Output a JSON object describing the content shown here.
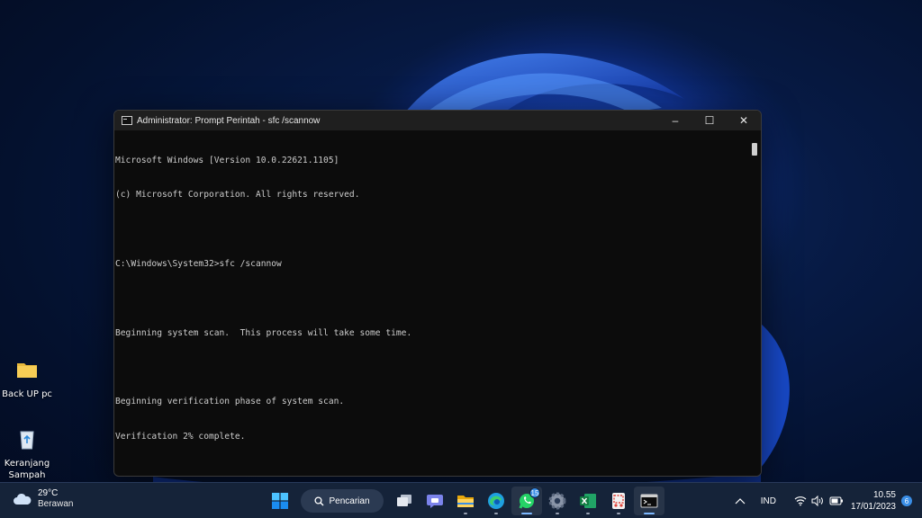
{
  "desktop": {
    "icons": [
      {
        "label": "Back UP pc"
      },
      {
        "label": "Keranjang\nSampah"
      }
    ]
  },
  "window": {
    "title": "Administrator: Prompt Perintah - sfc  /scannow",
    "controls": {
      "minimize": "–",
      "maximize": "☐",
      "close": "✕"
    },
    "console_lines": [
      "Microsoft Windows [Version 10.0.22621.1105]",
      "(c) Microsoft Corporation. All rights reserved.",
      "",
      "C:\\Windows\\System32>sfc /scannow",
      "",
      "Beginning system scan.  This process will take some time.",
      "",
      "Beginning verification phase of system scan.",
      "Verification 2% complete."
    ]
  },
  "taskbar": {
    "weather": {
      "temp": "29°C",
      "condition": "Berawan"
    },
    "search_label": "Pencarian",
    "apps": [
      {
        "name": "start-button",
        "icon": "windows-logo-icon"
      },
      {
        "name": "task-view-button",
        "icon": "task-view-icon"
      },
      {
        "name": "teams-button",
        "icon": "chat-icon"
      },
      {
        "name": "file-explorer-button",
        "icon": "folder-icon"
      },
      {
        "name": "edge-button",
        "icon": "edge-icon"
      },
      {
        "name": "whatsapp-button",
        "icon": "whatsapp-icon",
        "badge": "15"
      },
      {
        "name": "settings-button",
        "icon": "gear-icon"
      },
      {
        "name": "excel-button",
        "icon": "excel-icon"
      },
      {
        "name": "snipping-tool-button",
        "icon": "snipping-icon"
      },
      {
        "name": "terminal-button",
        "icon": "terminal-icon"
      }
    ],
    "tray": {
      "language": "IND",
      "time": "10.55",
      "date": "17/01/2023",
      "notification_count": "6"
    }
  },
  "colors": {
    "console_bg": "#0c0c0c",
    "console_text": "#cccccc",
    "taskbar_bg": "#152339",
    "accent": "#3a8ee6"
  }
}
